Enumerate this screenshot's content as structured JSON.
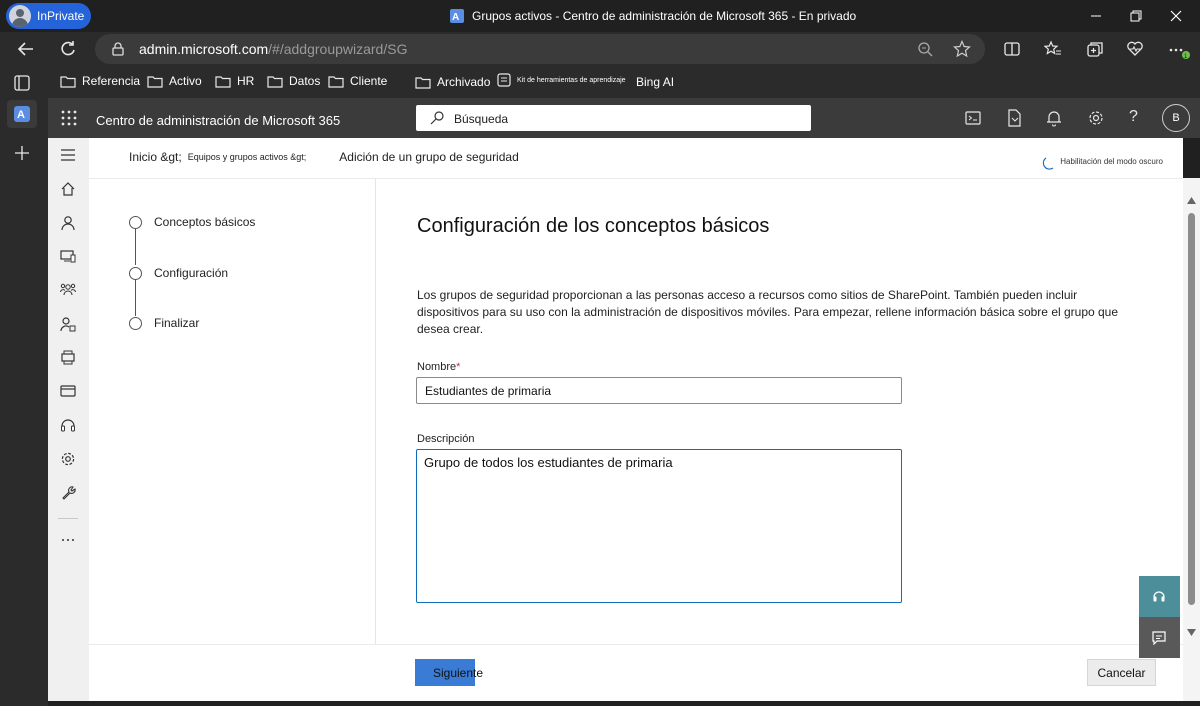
{
  "browser": {
    "inprivate_label": "InPrivate",
    "window_title": "Grupos activos - Centro de administración de Microsoft 365 - En privado",
    "url_host": "admin.microsoft.com",
    "url_path": "/#/addgroupwizard/SG",
    "favorites": [
      "Referencia",
      "Activo",
      "HR",
      "Datos",
      "Cliente",
      "Archivado",
      "Kit de herramientas de aprendizaje",
      "Bing AI"
    ],
    "extension_badge_color": "#6cc04a"
  },
  "header": {
    "app_title": "Centro de administración de Microsoft 365",
    "search_placeholder": "Búsqueda",
    "avatar_initial": "B"
  },
  "breadcrumb": {
    "home": "Inicio &gt;",
    "groups": "Equipos y grupos activos &gt;",
    "current": "Adición de un grupo de seguridad"
  },
  "dark_mode_label": "Habilitación del modo oscuro",
  "steps": [
    "Conceptos básicos",
    "Configuración",
    "Finalizar"
  ],
  "form": {
    "title": "Configuración de los conceptos básicos",
    "description": "Los grupos de seguridad proporcionan a las personas acceso a recursos como sitios de SharePoint. También pueden incluir dispositivos para su uso con la administración de dispositivos móviles. Para empezar, rellene información básica sobre el grupo que desea crear.",
    "name_label": "Nombre",
    "required_mark": "*",
    "name_value": "Estudiantes de primaria",
    "description_label": "Descripción",
    "description_value": "Grupo de todos los estudiantes de primaria"
  },
  "footer": {
    "next_label": "Siguiente",
    "cancel_label": "Cancelar"
  },
  "colors": {
    "accent": "#0f6cbd",
    "primary_button": "#3a7bd5",
    "help_button": "#4c8f9a",
    "inprivate_badge": "#2563d9"
  }
}
